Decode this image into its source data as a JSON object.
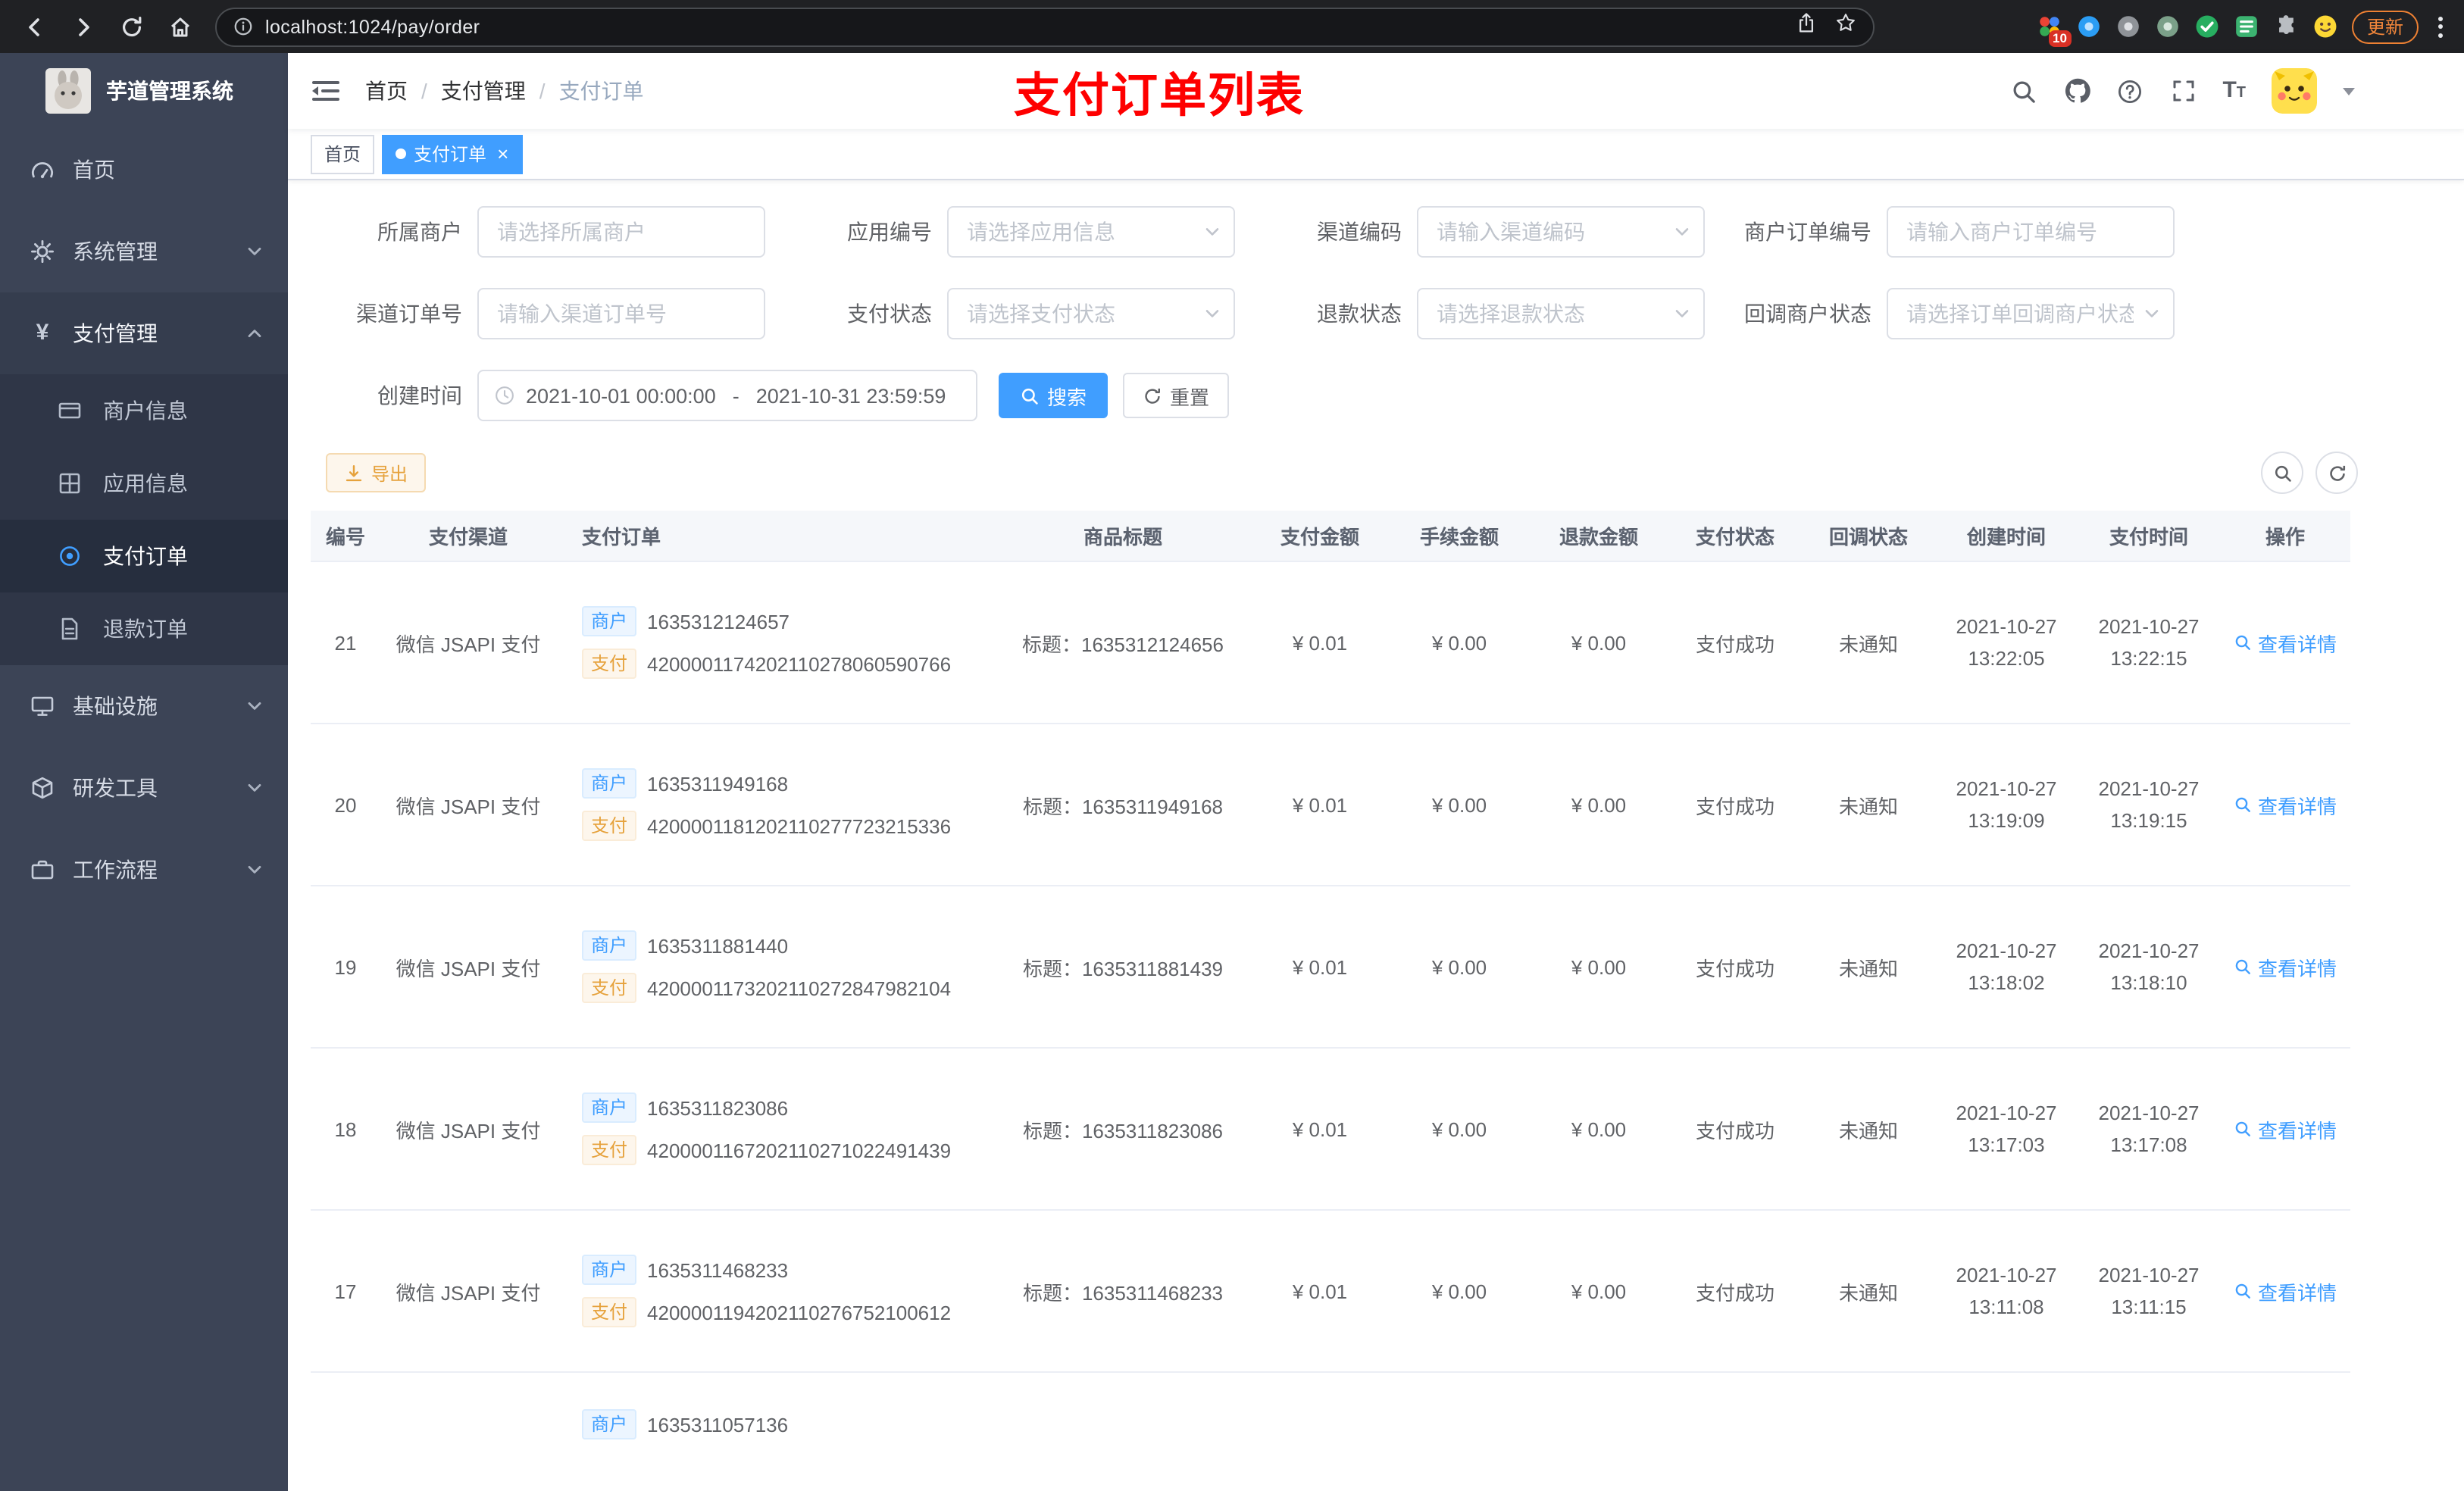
{
  "browser": {
    "url": "localhost:1024/pay/order",
    "update_label": "更新",
    "extension_badge": "10"
  },
  "app": {
    "title": "芋道管理系统"
  },
  "sidebar": {
    "items": {
      "home": "首页",
      "system": "系统管理",
      "pay": "支付管理",
      "merchant": "商户信息",
      "appinfo": "应用信息",
      "payorder": "支付订单",
      "refund": "退款订单",
      "infra": "基础设施",
      "devtools": "研发工具",
      "workflow": "工作流程"
    }
  },
  "header": {
    "breadcrumb": [
      "首页",
      "支付管理",
      "支付订单"
    ],
    "annotation": "支付订单列表"
  },
  "tabs": {
    "home": "首页",
    "current": "支付订单"
  },
  "filters": {
    "merchant": {
      "label": "所属商户",
      "placeholder": "请选择所属商户"
    },
    "app": {
      "label": "应用编号",
      "placeholder": "请选择应用信息"
    },
    "channel_code": {
      "label": "渠道编码",
      "placeholder": "请输入渠道编码"
    },
    "merchant_order_no": {
      "label": "商户订单编号",
      "placeholder": "请输入商户订单编号"
    },
    "channel_order_no": {
      "label": "渠道订单号",
      "placeholder": "请输入渠道订单号"
    },
    "pay_status": {
      "label": "支付状态",
      "placeholder": "请选择支付状态"
    },
    "refund_status": {
      "label": "退款状态",
      "placeholder": "请选择退款状态"
    },
    "notify_status": {
      "label": "回调商户状态",
      "placeholder": "请选择订单回调商户状态"
    },
    "create_time": {
      "label": "创建时间",
      "start": "2021-10-01 00:00:00",
      "separator": "-",
      "end": "2021-10-31 23:59:59"
    },
    "search": "搜索",
    "reset": "重置"
  },
  "toolbar": {
    "export": "导出"
  },
  "table": {
    "headers": [
      "编号",
      "支付渠道",
      "支付订单",
      "商品标题",
      "支付金额",
      "手续金额",
      "退款金额",
      "支付状态",
      "回调状态",
      "创建时间",
      "支付时间",
      "操作"
    ],
    "tag_merchant": "商户",
    "tag_pay": "支付",
    "action": "查看详情",
    "rows": [
      {
        "id": "21",
        "channel": "微信 JSAPI 支付",
        "merchant_no": "1635312124657",
        "channel_no": "4200001174202110278060590766",
        "title": "标题：1635312124656",
        "amount": "¥ 0.01",
        "fee": "¥ 0.00",
        "refund": "¥ 0.00",
        "status": "支付成功",
        "notify": "未通知",
        "create_date": "2021-10-27",
        "create_time": "13:22:05",
        "pay_date": "2021-10-27",
        "pay_time": "13:22:15"
      },
      {
        "id": "20",
        "channel": "微信 JSAPI 支付",
        "merchant_no": "1635311949168",
        "channel_no": "4200001181202110277723215336",
        "title": "标题：1635311949168",
        "amount": "¥ 0.01",
        "fee": "¥ 0.00",
        "refund": "¥ 0.00",
        "status": "支付成功",
        "notify": "未通知",
        "create_date": "2021-10-27",
        "create_time": "13:19:09",
        "pay_date": "2021-10-27",
        "pay_time": "13:19:15"
      },
      {
        "id": "19",
        "channel": "微信 JSAPI 支付",
        "merchant_no": "1635311881440",
        "channel_no": "4200001173202110272847982104",
        "title": "标题：1635311881439",
        "amount": "¥ 0.01",
        "fee": "¥ 0.00",
        "refund": "¥ 0.00",
        "status": "支付成功",
        "notify": "未通知",
        "create_date": "2021-10-27",
        "create_time": "13:18:02",
        "pay_date": "2021-10-27",
        "pay_time": "13:18:10"
      },
      {
        "id": "18",
        "channel": "微信 JSAPI 支付",
        "merchant_no": "1635311823086",
        "channel_no": "4200001167202110271022491439",
        "title": "标题：1635311823086",
        "amount": "¥ 0.01",
        "fee": "¥ 0.00",
        "refund": "¥ 0.00",
        "status": "支付成功",
        "notify": "未通知",
        "create_date": "2021-10-27",
        "create_time": "13:17:03",
        "pay_date": "2021-10-27",
        "pay_time": "13:17:08"
      },
      {
        "id": "17",
        "channel": "微信 JSAPI 支付",
        "merchant_no": "1635311468233",
        "channel_no": "4200001194202110276752100612",
        "title": "标题：1635311468233",
        "amount": "¥ 0.01",
        "fee": "¥ 0.00",
        "refund": "¥ 0.00",
        "status": "支付成功",
        "notify": "未通知",
        "create_date": "2021-10-27",
        "create_time": "13:11:08",
        "pay_date": "2021-10-27",
        "pay_time": "13:11:15"
      }
    ],
    "partial_row": {
      "merchant_no": "1635311057136"
    }
  },
  "colors": {
    "accent": "#409eff",
    "warning": "#e6a23c",
    "annotation": "#ff0000",
    "sidebar_bg": "#3c4456",
    "browser_bar": "#202124"
  }
}
